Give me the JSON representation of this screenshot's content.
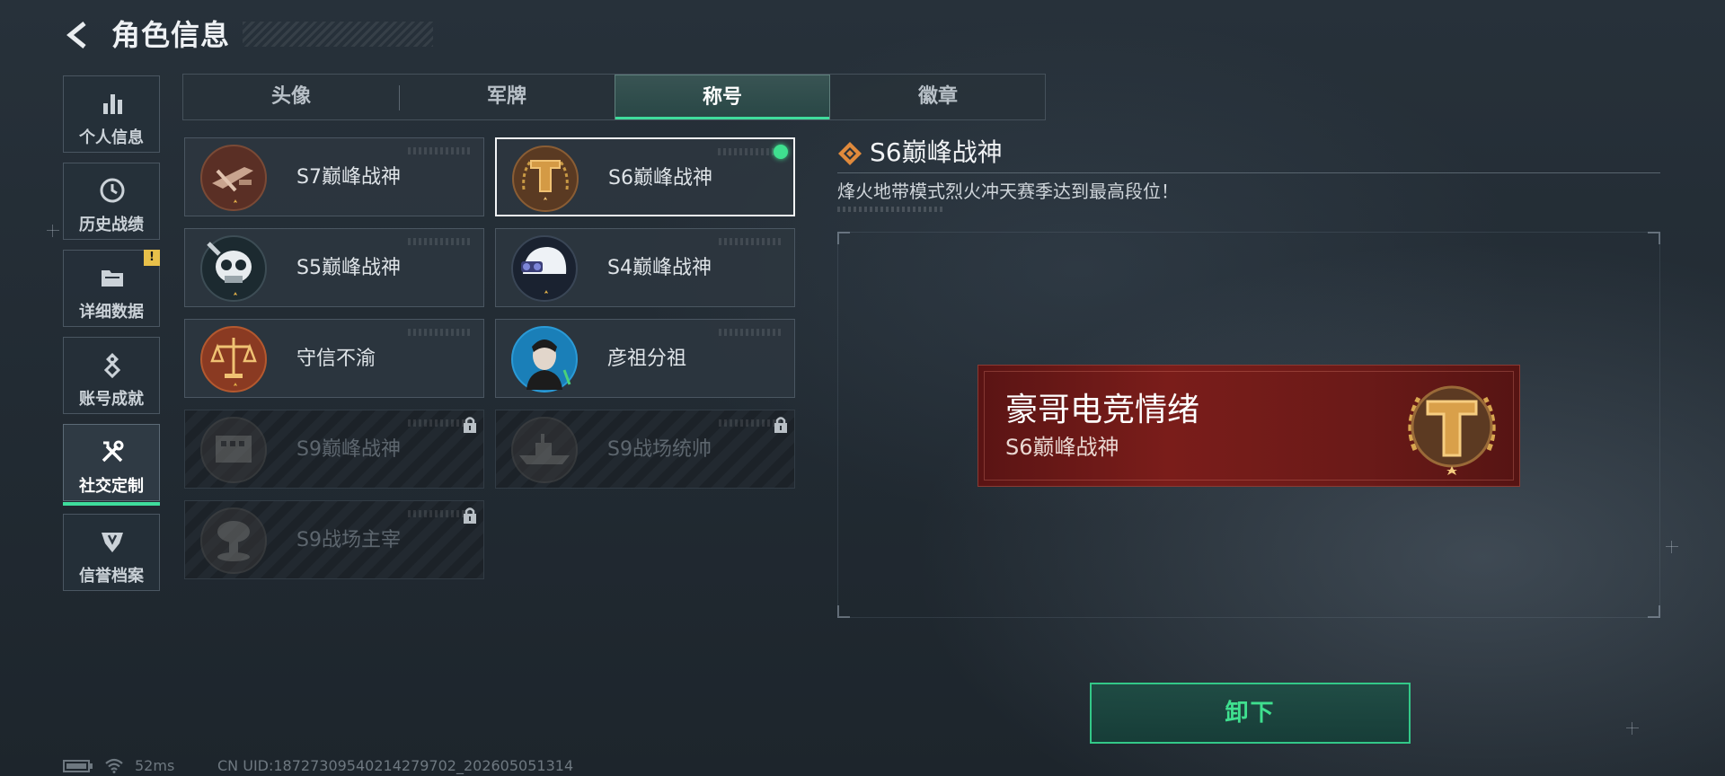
{
  "header": {
    "title": "角色信息"
  },
  "sidebar": {
    "items": [
      {
        "label": "个人信息",
        "icon": "bar-chart-icon",
        "active": false
      },
      {
        "label": "历史战绩",
        "icon": "history-clock-icon",
        "active": false
      },
      {
        "label": "详细数据",
        "icon": "folder-icon",
        "active": false,
        "badge": "!"
      },
      {
        "label": "账号成就",
        "icon": "achievement-icon",
        "active": false
      },
      {
        "label": "社交定制",
        "icon": "tools-icon",
        "active": true
      },
      {
        "label": "信誉档案",
        "icon": "credit-shield-icon",
        "active": false
      }
    ]
  },
  "tabs": [
    {
      "label": "头像",
      "active": false
    },
    {
      "label": "军牌",
      "active": false
    },
    {
      "label": "称号",
      "active": true
    },
    {
      "label": "徽章",
      "active": false
    }
  ],
  "titles": [
    {
      "name": "S7巅峰战神",
      "emblem": "crossbow-emblem",
      "locked": false
    },
    {
      "name": "S6巅峰战神",
      "emblem": "t-shield-emblem",
      "locked": false,
      "selected": true,
      "equipped": true
    },
    {
      "name": "S5巅峰战神",
      "emblem": "skull-mask-emblem",
      "locked": false
    },
    {
      "name": "S4巅峰战神",
      "emblem": "helmet-emblem",
      "locked": false
    },
    {
      "name": "守信不渝",
      "emblem": "scales-emblem",
      "locked": false
    },
    {
      "name": "彦祖分祖",
      "emblem": "portrait-emblem",
      "locked": false
    },
    {
      "name": "S9巅峰战神",
      "emblem": "building-emblem",
      "locked": true
    },
    {
      "name": "S9战场统帅",
      "emblem": "warship-emblem",
      "locked": true
    },
    {
      "name": "S9战场主宰",
      "emblem": "mushroom-cloud-emblem",
      "locked": true
    }
  ],
  "detail": {
    "title": "S6巅峰战神",
    "description": "烽火地带模式烈火冲天赛季达到最高段位！",
    "icon": "diamond-rank-icon"
  },
  "banner": {
    "player_name": "豪哥电竞情绪",
    "title": "S6巅峰战神"
  },
  "unequip_button": {
    "label": "卸下"
  },
  "status": {
    "ping": "52ms",
    "uid": "CN UID:18727309540214279702_202605051314"
  },
  "colors": {
    "accent": "#3fdc9c",
    "banner": "#7a1d1a",
    "gold": "#d39a43"
  }
}
